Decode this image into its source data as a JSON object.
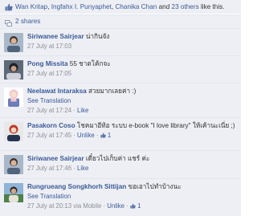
{
  "likes": {
    "likers": [
      "Wan Kritap",
      "Ingfahx I. Punyaphet",
      "Chanika Chan"
    ],
    "separator": ", ",
    "and_text": " and ",
    "others": "23 others",
    "suffix": " like this."
  },
  "shares": {
    "label": "2 shares"
  },
  "comments": [
    {
      "author": "Siriwanee Sairjear",
      "text": "น่ากินจัง",
      "time": "27 July at 17:03"
    },
    {
      "author": "Pong Missita",
      "text": "55 ชาตโค้กจะ",
      "time": "27 July at 17:05"
    },
    {
      "author": "Neelawat Intaraksa",
      "text": "สวยมากเลยค่า :)",
      "see_translation": "See Translation",
      "time": "27 July at 17:24",
      "action": "Like"
    },
    {
      "author": "Pasakorn Coso",
      "text": "โชคมาอีท้อ ระบบ e-book \"I love library\" ให้เค้านะเนี่ย ;)",
      "time": "27 July at 17:45",
      "action": "Unlike",
      "likes": "1"
    },
    {
      "author": "Siriwanee Sairjear",
      "text": "เดี๋ยวไปเก็บค่า แชร์ ค่ะ",
      "time": "27 July at 17:46",
      "action": "Like"
    },
    {
      "author": "Rungrueang Songkhorh Sittijan",
      "text": "ขอเอาไปทำบ้างนะ",
      "see_translation": "See Translation",
      "time": "27 July at 20:13 via Mobile",
      "action": "Unlike",
      "likes": "1"
    }
  ],
  "colors": {
    "link": "#3b5998",
    "background": "#edeff4",
    "meta": "#8a8f98"
  },
  "icons": {
    "likes": "thumbs-up-icon",
    "shares": "share-icon",
    "comment_likes": "thumbs-up-icon"
  }
}
